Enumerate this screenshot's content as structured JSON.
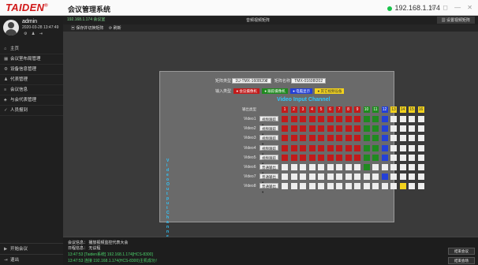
{
  "app": {
    "brand": "TAIDEN",
    "brand_mark": "®",
    "title": "会议管理系统",
    "ip": "192.168.1.174",
    "ip_status_color": "#19c34a"
  },
  "user": {
    "name": "admin",
    "datetime": "2020-03-28 13:47:49"
  },
  "nav": {
    "items": [
      "主页",
      "会议室布局管理",
      "设备信息管理",
      "代表管理",
      "会议信息",
      "与会代表管理",
      "人员报到"
    ],
    "bottom": [
      "开始会议",
      "退出"
    ]
  },
  "tabbar": {
    "left": "192.168.1.174 会议室",
    "center": "音频视频矩阵",
    "right": "设置视频矩阵"
  },
  "toolbar": {
    "save": "保存并切换矩阵",
    "refresh": "刷新"
  },
  "panel": {
    "type_label": "矩阵类型",
    "type_value": "1U-TMX-1608I202",
    "name_label": "矩阵名称",
    "name_value": "TMX-01608I202",
    "input_type_label": "输入类型",
    "legend": [
      {
        "label": "会议摄像机",
        "color": "#c21a1a",
        "text": "#ffffff"
      },
      {
        "label": "跟踪摄像机",
        "color": "#1f8a1f",
        "text": "#ffffff"
      },
      {
        "label": "电脑显示",
        "color": "#2440d6",
        "text": "#ffffff"
      },
      {
        "label": "其它视频设备",
        "color": "#f2d21d",
        "text": "#333333"
      }
    ],
    "input_title": "Video Input Channel",
    "output_title": "Video Output Channel",
    "col_label": "输出类型",
    "columns": [
      "1",
      "2",
      "3",
      "4",
      "5",
      "6",
      "7",
      "8",
      "9",
      "10",
      "11",
      "12",
      "13",
      "14",
      "15",
      "16"
    ],
    "column_colors": [
      "#c21a1a",
      "#c21a1a",
      "#c21a1a",
      "#c21a1a",
      "#c21a1a",
      "#c21a1a",
      "#c21a1a",
      "#c21a1a",
      "#c21a1a",
      "#1f8a1f",
      "#1f8a1f",
      "#2440d6",
      "#f2d21d",
      "#f2d21d",
      "#f2d21d",
      "#f2d21d"
    ],
    "rows": [
      {
        "label": "Video1",
        "type": "视频跟踪",
        "cells": "RRRRRRRRRGGBWWWW"
      },
      {
        "label": "Video2",
        "type": "视频跟踪",
        "cells": "RRRRRRRRRGGBWWWW"
      },
      {
        "label": "Video3",
        "type": "视频跟踪",
        "cells": "RRRRRRRRRGGBWWWW"
      },
      {
        "label": "Video4",
        "type": "视频跟踪",
        "cells": "RRRRRRRRRGGBWWWW"
      },
      {
        "label": "Video5",
        "type": "视频跟踪",
        "cells": "RRRRRRRRRGGBWWWW"
      },
      {
        "label": "Video6",
        "type": "普通输出",
        "cells": "WWWWWWWWWGWWWWWW"
      },
      {
        "label": "Video7",
        "type": "普通输出",
        "cells": "WWWWWWWWWWWBWWWW"
      },
      {
        "label": "Video8",
        "type": "普通输出",
        "cells": "WWWWWWWWWWWWWYWW"
      }
    ],
    "cell_colors": {
      "R": "#c21a1a",
      "G": "#1f8a1f",
      "B": "#2440d6",
      "Y": "#f2d21d",
      "W": "#eeeeee"
    }
  },
  "status": {
    "line1": "会议信息：  播放视频监控代表大会",
    "line2": "日程信息：  无议程",
    "line3": "13:47:53  [Taiden系统] 192.168.1.174[HCS-8300]",
    "line4": "13:47:53  连接 192.168.1.174(HCS-8300)主机成功！",
    "btn_start": "结束会议",
    "btn_screen": "结束会场"
  }
}
